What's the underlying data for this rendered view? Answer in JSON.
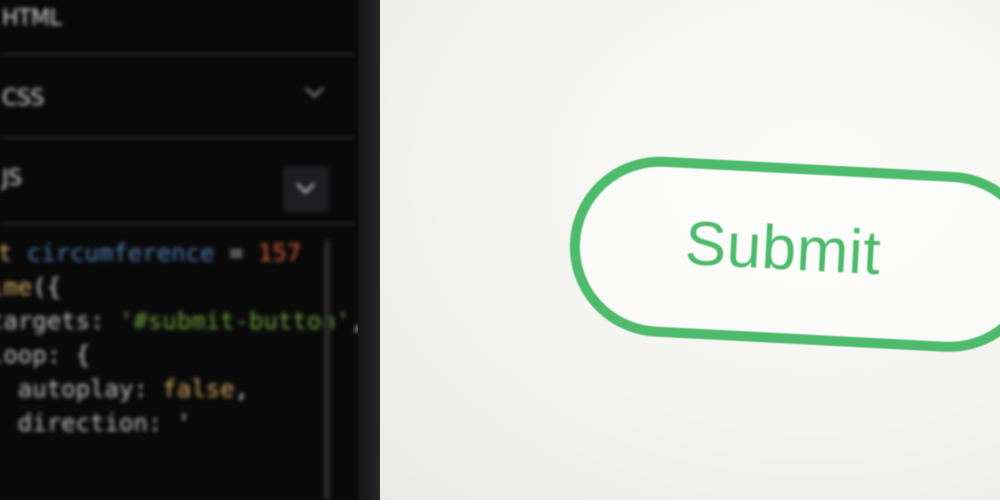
{
  "editor": {
    "panels": [
      {
        "label": "HTML"
      },
      {
        "label": "CSS"
      },
      {
        "label": "JS"
      }
    ],
    "code_lines": [
      [
        {
          "t": "kw",
          "v": "const "
        },
        {
          "t": "var",
          "v": "circumference"
        },
        {
          "t": "op",
          "v": " = "
        },
        {
          "t": "num",
          "v": "157"
        }
      ],
      [
        {
          "t": "kw",
          "v": "anime"
        },
        {
          "t": "pun",
          "v": "({"
        }
      ],
      [
        {
          "t": "op",
          "v": "  targets: "
        },
        {
          "t": "str",
          "v": "'#submit-button'"
        },
        {
          "t": "pun",
          "v": ","
        }
      ],
      [
        {
          "t": "op",
          "v": "  loop: "
        },
        {
          "t": "pun",
          "v": "{"
        }
      ],
      [
        {
          "t": "op",
          "v": "    autoplay: "
        },
        {
          "t": "kw",
          "v": "false"
        },
        {
          "t": "pun",
          "v": ","
        }
      ],
      [
        {
          "t": "op",
          "v": "    direction: "
        },
        {
          "t": "pun",
          "v": "'"
        }
      ]
    ]
  },
  "preview": {
    "submit_label": "Submit"
  },
  "colors": {
    "editor_bg": "#0a0a0b",
    "button_accent": "#4dbb6b",
    "preview_bg": "#f3f3ef"
  }
}
